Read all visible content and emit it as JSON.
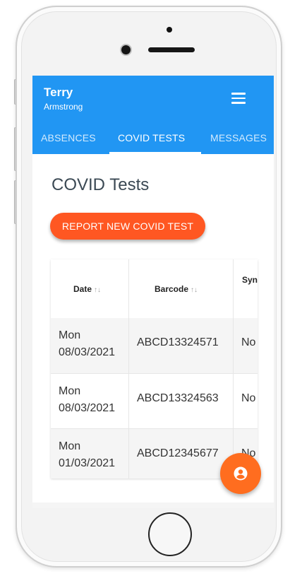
{
  "header": {
    "user_name": "Terry",
    "user_sub": "Armstrong",
    "menu_icon": "hamburger-menu-icon"
  },
  "tabs": [
    {
      "label": "ABSENCES",
      "active": false
    },
    {
      "label": "COVID TESTS",
      "active": true
    },
    {
      "label": "MESSAGES",
      "active": false
    }
  ],
  "page": {
    "title": "COVID Tests",
    "report_button": "REPORT NEW COVID TEST"
  },
  "table": {
    "headers": [
      "Date",
      "Barcode",
      "Syn"
    ],
    "sort_icon": "sort-arrows-icon",
    "rows": [
      {
        "day": "Mon",
        "date": "08/03/2021",
        "barcode": "ABCD13324571",
        "symptoms": "No"
      },
      {
        "day": "Mon",
        "date": "08/03/2021",
        "barcode": "ABCD13324563",
        "symptoms": "No"
      },
      {
        "day": "Mon",
        "date": "01/03/2021",
        "barcode": "ABCD12345677",
        "symptoms": "No"
      }
    ]
  },
  "fab": {
    "icon": "account-circle-icon"
  },
  "colors": {
    "appbar": "#2196f3",
    "report_button": "#ff5722",
    "fab": "#ff6d1f"
  }
}
